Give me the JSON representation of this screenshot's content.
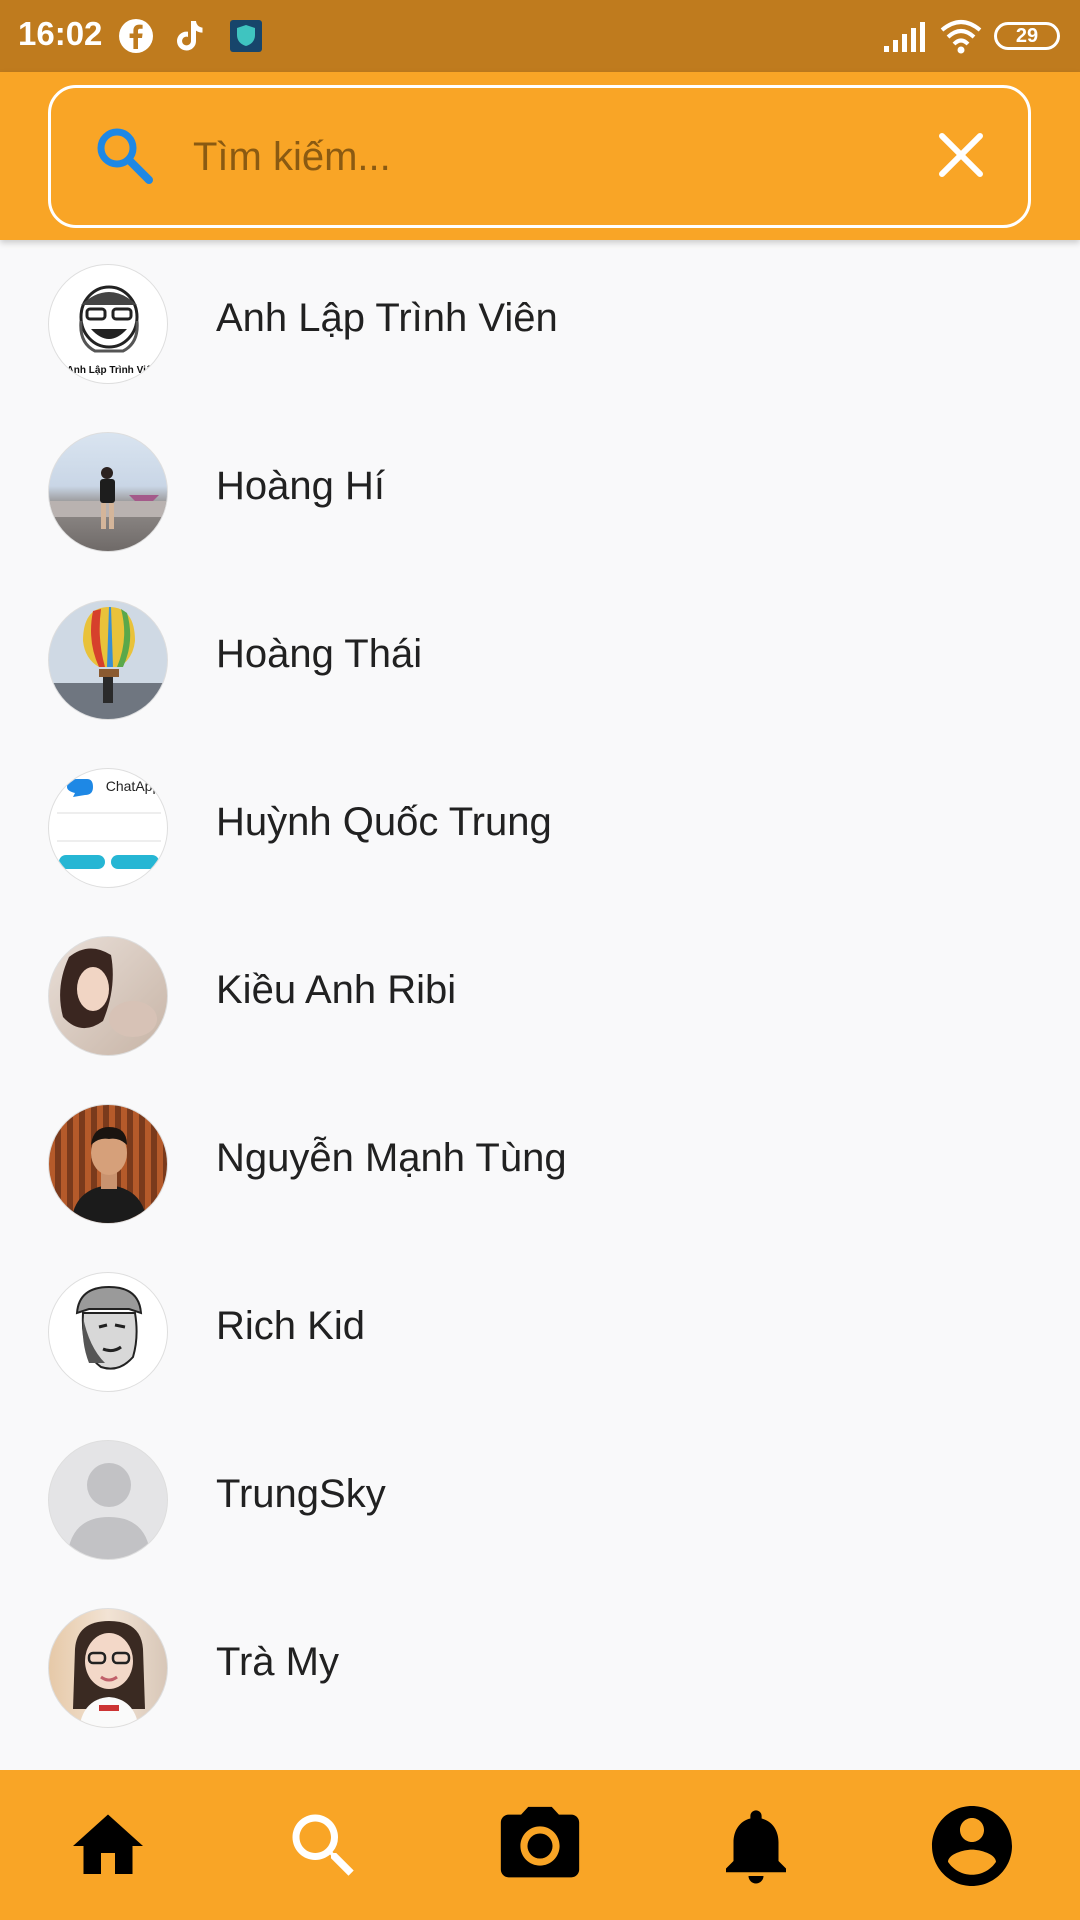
{
  "status_bar": {
    "time": "16:02",
    "notification_icons": [
      "facebook-icon",
      "tiktok-icon",
      "vpn-shield-icon"
    ],
    "signal_icon": "cellular-signal-icon",
    "wifi_icon": "wifi-icon",
    "battery": "29"
  },
  "search": {
    "placeholder": "Tìm kiếm...",
    "value": "",
    "search_icon": "search-icon",
    "clear_icon": "close-icon"
  },
  "contacts": [
    {
      "name": "Anh Lập Trình Viên",
      "avatar_caption": "Anh Lập Trình Viê"
    },
    {
      "name": "Hoàng Hí"
    },
    {
      "name": "Hoàng Thái"
    },
    {
      "name": "Huỳnh Quốc Trung",
      "avatar_caption": "ChatApp"
    },
    {
      "name": "Kiều Anh Ribi"
    },
    {
      "name": "Nguyễn Mạnh Tùng"
    },
    {
      "name": "Rich Kid"
    },
    {
      "name": "TrungSky"
    },
    {
      "name": "Trà My"
    }
  ],
  "bottom_nav": [
    {
      "icon": "home-icon",
      "active": false
    },
    {
      "icon": "search-icon",
      "active": true
    },
    {
      "icon": "camera-icon",
      "active": false
    },
    {
      "icon": "bell-icon",
      "active": false
    },
    {
      "icon": "account-icon",
      "active": false
    }
  ],
  "colors": {
    "status_bar": "#bf7b1e",
    "app_bar": "#f9a526",
    "search_icon": "#1e88e5",
    "active_nav_icon": "#ffffff",
    "inactive_nav_icon": "#000000"
  }
}
